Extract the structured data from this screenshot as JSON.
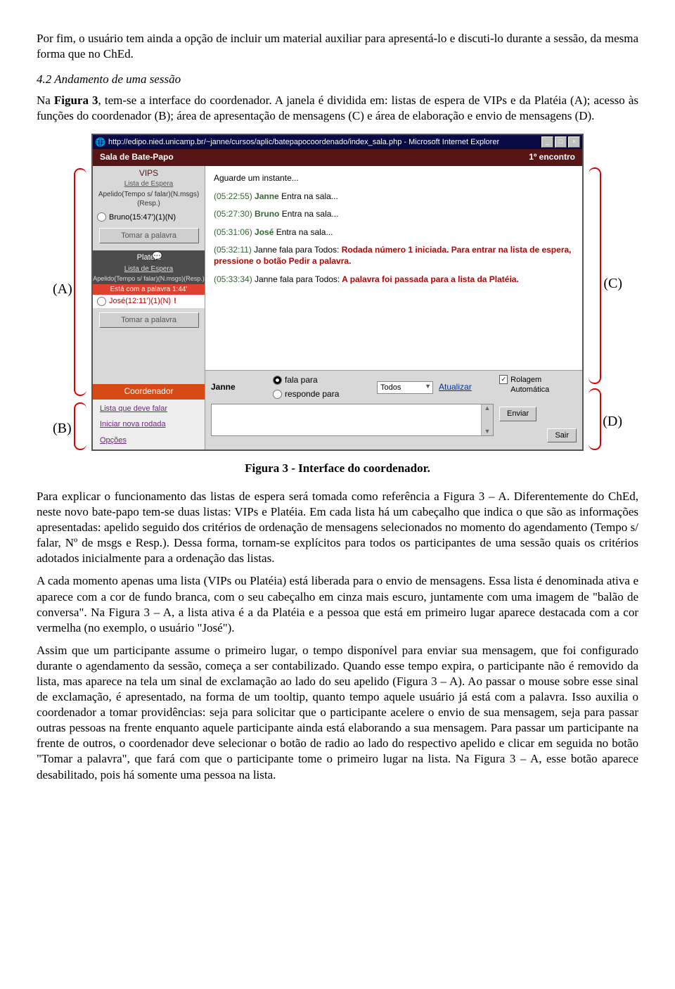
{
  "paragraphs": {
    "p1": "Por fim, o usuário tem ainda a opção de incluir um material auxiliar para apresentá-lo e discuti-lo durante a sessão, da mesma forma que no ChEd.",
    "h42": "4.2 Andamento de uma sessão",
    "p2_a": "Na ",
    "p2_b": "Figura 3",
    "p2_c": ", tem-se a interface do coordenador. A janela é dividida em: listas de espera de VIPs e da Platéia (A); acesso às funções do coordenador (B); área de apresentação de mensagens (C) e área de elaboração e envio de mensagens (D).",
    "figcaption": "Figura 3 - Interface do coordenador.",
    "p3": "Para explicar o funcionamento das listas de espera será tomada como referência a Figura 3 – A. Diferentemente do ChEd, neste novo bate-papo tem-se duas listas: VIPs e Platéia. Em cada lista há um cabeçalho que indica o que são as informações apresentadas: apelido seguido dos critérios de ordenação de mensagens selecionados no momento do agendamento (Tempo s/ falar, Nº de msgs e Resp.). Dessa forma, tornam-se explícitos para todos os participantes de uma sessão quais os critérios adotados inicialmente para a ordenação das listas.",
    "p4": "A cada momento apenas uma lista (VIPs ou Platéia) está liberada para o envio de mensagens. Essa lista é denominada ativa e aparece com a cor de fundo branca, com o seu cabeçalho em cinza mais escuro, juntamente com uma imagem de \"balão de conversa\". Na Figura 3 – A, a lista ativa é a da Platéia e a pessoa que está em primeiro lugar aparece destacada com a cor vermelha (no exemplo, o usuário \"José\").",
    "p5": "Assim que um participante assume o primeiro lugar, o tempo disponível para enviar sua mensagem, que foi configurado durante o agendamento da sessão, começa a ser contabilizado. Quando esse tempo expira, o participante não é removido da lista, mas aparece na tela um sinal de exclamação ao lado do seu apelido (Figura 3 – A). Ao passar o mouse sobre esse sinal de exclamação, é apresentado, na forma de um tooltip, quanto tempo aquele usuário já está com a palavra. Isso auxilia o coordenador a tomar providências: seja para solicitar que o participante acelere o envio de sua mensagem, seja para passar outras pessoas na frente enquanto aquele participante ainda está elaborando a sua mensagem. Para passar um participante na frente de outros, o coordenador deve selecionar o botão de radio ao lado do respectivo apelido e clicar em seguida no botão \"Tomar a palavra\", que fará com que o participante tome o primeiro lugar na lista. Na Figura 3 – A, esse botão aparece desabilitado, pois há somente uma pessoa na lista."
  },
  "callouts": {
    "A": "(A)",
    "B": "(B)",
    "C": "(C)",
    "D": "(D)"
  },
  "window": {
    "url": "http://edipo.nied.unicamp.br/~janne/cursos/aplic/batepapocoordenado/index_sala.php - Microsoft Internet Explorer",
    "header_left": "Sala de Bate-Papo",
    "header_right": "1º encontro",
    "vips": {
      "title": "VIPS",
      "sub": "Lista de Espera",
      "cols": "Apelido(Tempo s/ falar)(N.msgs)(Resp.)",
      "entry": "Bruno(15:47')(1)(N)",
      "btn": "Tomar a palavra"
    },
    "plateia": {
      "title": "Platéia",
      "balloon": "💬",
      "sub": "Lista de Espera",
      "cols": "Apelido(Tempo s/ falar)(N.msgs)(Resp.)",
      "active": "Está com a palavra 1:44'",
      "entry_name": "José(12:11')(1)(N)",
      "excl": "!",
      "btn": "Tomar a palavra"
    },
    "coord": {
      "title": "Coordenador",
      "l1": "Lista que deve falar",
      "l2": "Iniciar nova rodada",
      "l3": "Opções"
    },
    "messages": {
      "wait": "Aguarde um instante...",
      "m1_ts": "(05:22:55)",
      "m1_who": "Janne",
      "m1_txt": "Entra na sala...",
      "m2_ts": "(05:27:30)",
      "m2_who": "Bruno",
      "m2_txt": "Entra na sala...",
      "m3_ts": "(05:31:06)",
      "m3_who": "José",
      "m3_txt": "Entra na sala...",
      "m4_ts": "(05:32:11)",
      "m4_pre": "Janne fala para Todos:",
      "m4_txt": "Rodada número 1 iniciada. Para entrar na lista de espera, pressione o botão Pedir a palavra.",
      "m5_ts": "(05:33:34)",
      "m5_pre": "Janne fala para Todos:",
      "m5_txt": "A palavra foi passada para a lista da Platéia."
    },
    "compose": {
      "name": "Janne",
      "r1": "fala para",
      "r2": "responde para",
      "target": "Todos",
      "atualizar": "Atualizar",
      "rolagem": "Rolagem Automática",
      "enviar": "Enviar",
      "sair": "Sair"
    }
  }
}
